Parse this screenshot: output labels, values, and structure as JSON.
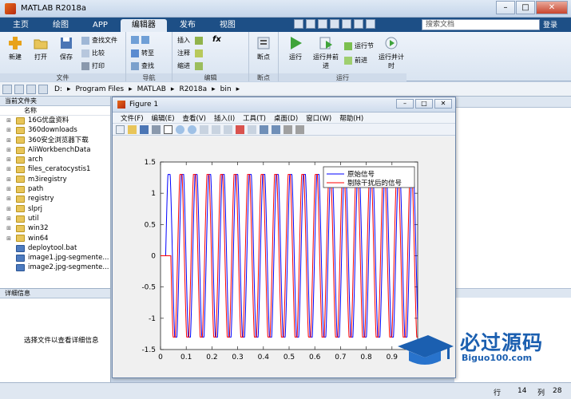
{
  "window": {
    "title": "MATLAB R2018a",
    "btn_min": "–",
    "btn_max": "□",
    "btn_close": "✕"
  },
  "tabs": [
    "主页",
    "绘图",
    "APP",
    "编辑器",
    "发布",
    "视图"
  ],
  "active_tab": 3,
  "search": {
    "placeholder": "搜索文档"
  },
  "login": "登录",
  "ribbon": {
    "file": {
      "new": "新建",
      "open": "打开",
      "save": "保存",
      "find_files": "查找文件",
      "compare": "比较",
      "print": "打印",
      "group": "文件"
    },
    "nav": {
      "goto": "转至",
      "find": "查找",
      "group": "导航"
    },
    "edit": {
      "insert": "插入",
      "comment": "注释",
      "indent": "缩进",
      "fx": "fx",
      "group": "编辑"
    },
    "breakpoints": {
      "bp": "断点",
      "group": "断点"
    },
    "run": {
      "run": "运行",
      "run_advance": "运行并前进",
      "run_section": "运行节",
      "advance": "前进",
      "run_time": "运行并计时",
      "group": "运行"
    }
  },
  "address": {
    "segments": [
      "D:",
      "Program Files",
      "MATLAB",
      "R2018a",
      "bin"
    ]
  },
  "current_folder": {
    "title": "当前文件夹",
    "col_name": "名称",
    "items": [
      {
        "name": "16G优盘资料",
        "type": "folder"
      },
      {
        "name": "360downloads",
        "type": "folder"
      },
      {
        "name": "360安全浏览器下载",
        "type": "folder"
      },
      {
        "name": "AliWorkbenchData",
        "type": "folder"
      },
      {
        "name": "arch",
        "type": "folder"
      },
      {
        "name": "files_ceratocystis1",
        "type": "folder"
      },
      {
        "name": "m3iregistry",
        "type": "folder"
      },
      {
        "name": "path",
        "type": "folder"
      },
      {
        "name": "registry",
        "type": "folder"
      },
      {
        "name": "slprj",
        "type": "folder"
      },
      {
        "name": "util",
        "type": "folder"
      },
      {
        "name": "win32",
        "type": "folder"
      },
      {
        "name": "win64",
        "type": "folder"
      },
      {
        "name": "deploytool.bat",
        "type": "file"
      },
      {
        "name": "image1.jpg-segmente...",
        "type": "file"
      },
      {
        "name": "image2.jpg-segmente...",
        "type": "file"
      }
    ]
  },
  "details": {
    "title": "详细信息",
    "empty": "选择文件以查看详细信息"
  },
  "figure": {
    "title": "Figure 1",
    "menu": [
      "文件(F)",
      "编辑(E)",
      "查看(V)",
      "插入(I)",
      "工具(T)",
      "桌面(D)",
      "窗口(W)",
      "帮助(H)"
    ]
  },
  "chart_data": {
    "type": "line",
    "xlim": [
      0,
      1
    ],
    "ylim": [
      -1.5,
      1.5
    ],
    "xticks": [
      "0",
      "0.1",
      "0.2",
      "0.3",
      "0.4",
      "0.5",
      "0.6",
      "0.7",
      "0.8",
      "0.9"
    ],
    "yticks": [
      "1.5",
      "1",
      "0.5",
      "0",
      "-0.5",
      "-1",
      "-1.5"
    ],
    "legend_position": "top-right",
    "series": [
      {
        "name": "原始信号",
        "color": "#0000ff",
        "amplitude": 1.3,
        "frequency_hz": 19,
        "start": 0.02
      },
      {
        "name": "剔除干扰后的信号",
        "color": "#ff0000",
        "amplitude": 1.3,
        "frequency_hz": 19,
        "start": 0.04
      }
    ]
  },
  "statusbar": {
    "row_label": "行",
    "row": "14",
    "col_label": "列",
    "col": "28"
  },
  "watermark": {
    "text": "必过源码",
    "url": "Biguo100.com"
  }
}
